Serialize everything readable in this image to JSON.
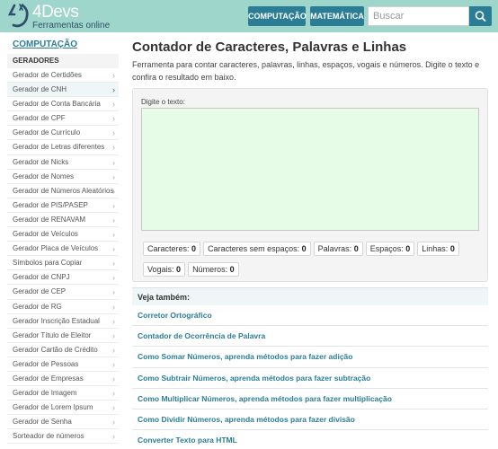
{
  "header": {
    "logo_title": "4Devs",
    "logo_subtitle": "Ferramentas online",
    "nav": [
      {
        "label": "COMPUTAÇÃO"
      },
      {
        "label": "MATEMÁTICA"
      }
    ],
    "search": {
      "placeholder": "Buscar",
      "value": ""
    }
  },
  "sidebar": {
    "heading": "COMPUTAÇÃO",
    "section": "GERADORES",
    "items": [
      {
        "label": "Gerador de Certidões"
      },
      {
        "label": "Gerador de CNH",
        "active": true
      },
      {
        "label": "Gerador de Conta Bancária"
      },
      {
        "label": "Gerador de CPF"
      },
      {
        "label": "Gerador de Currículo"
      },
      {
        "label": "Gerador de Letras diferentes"
      },
      {
        "label": "Gerador de Nicks"
      },
      {
        "label": "Gerador de Nomes"
      },
      {
        "label": "Gerador de Números Aleatórios"
      },
      {
        "label": "Gerador de PIS/PASEP"
      },
      {
        "label": "Gerador de RENAVAM"
      },
      {
        "label": "Gerador de Veículos"
      },
      {
        "label": "Gerador Placa de Veículos"
      },
      {
        "label": "Símbolos para Copiar"
      },
      {
        "label": "Gerador de CNPJ"
      },
      {
        "label": "Gerador de CEP"
      },
      {
        "label": "Gerador de RG"
      },
      {
        "label": "Gerador Inscrição Estadual"
      },
      {
        "label": "Gerador Título de Eleitor"
      },
      {
        "label": "Gerador Cartão de Crédito"
      },
      {
        "label": "Gerador de Pessoas"
      },
      {
        "label": "Gerador de Empresas"
      },
      {
        "label": "Gerador de Imagem"
      },
      {
        "label": "Gerador de Lorem Ipsum"
      },
      {
        "label": "Gerador de Senha"
      },
      {
        "label": "Sorteador de números"
      }
    ]
  },
  "main": {
    "title": "Contador de Caracteres, Palavras e Linhas",
    "description": "Ferramenta para contar caracteres, palavras, linhas, espaços, vogais e números. Digite o texto e confira o resultado em baixo.",
    "input_label": "Digite o texto:",
    "input_value": "",
    "stats": [
      {
        "label": "Caracteres:",
        "value": "0"
      },
      {
        "label": "Caracteres sem espaços:",
        "value": "0"
      },
      {
        "label": "Palavras:",
        "value": "0"
      },
      {
        "label": "Espaços:",
        "value": "0"
      },
      {
        "label": "Linhas:",
        "value": "0"
      },
      {
        "label": "Vogais:",
        "value": "0"
      },
      {
        "label": "Números:",
        "value": "0"
      }
    ],
    "see_also": {
      "heading": "Veja também:",
      "links": [
        {
          "label": "Corretor Ortográfico"
        },
        {
          "label": "Contador de Ocorrência de Palavra"
        },
        {
          "label": "Como Somar Números, aprenda métodos para fazer adição"
        },
        {
          "label": "Como Subtrair Números, aprenda métodos para fazer subtração"
        },
        {
          "label": "Como Multiplicar Números, aprenda métodos para fazer multiplicação"
        },
        {
          "label": "Como Dividir Números, aprenda métodos para fazer divisão"
        },
        {
          "label": "Converter Texto para HTML"
        }
      ]
    }
  },
  "colors": {
    "header_bg": "#9ed6cc",
    "accent": "#2b7d96",
    "textarea_bg": "#e6fce6"
  },
  "icons": [
    "logo-mark-icon",
    "search-icon",
    "chevron-right-icon"
  ]
}
